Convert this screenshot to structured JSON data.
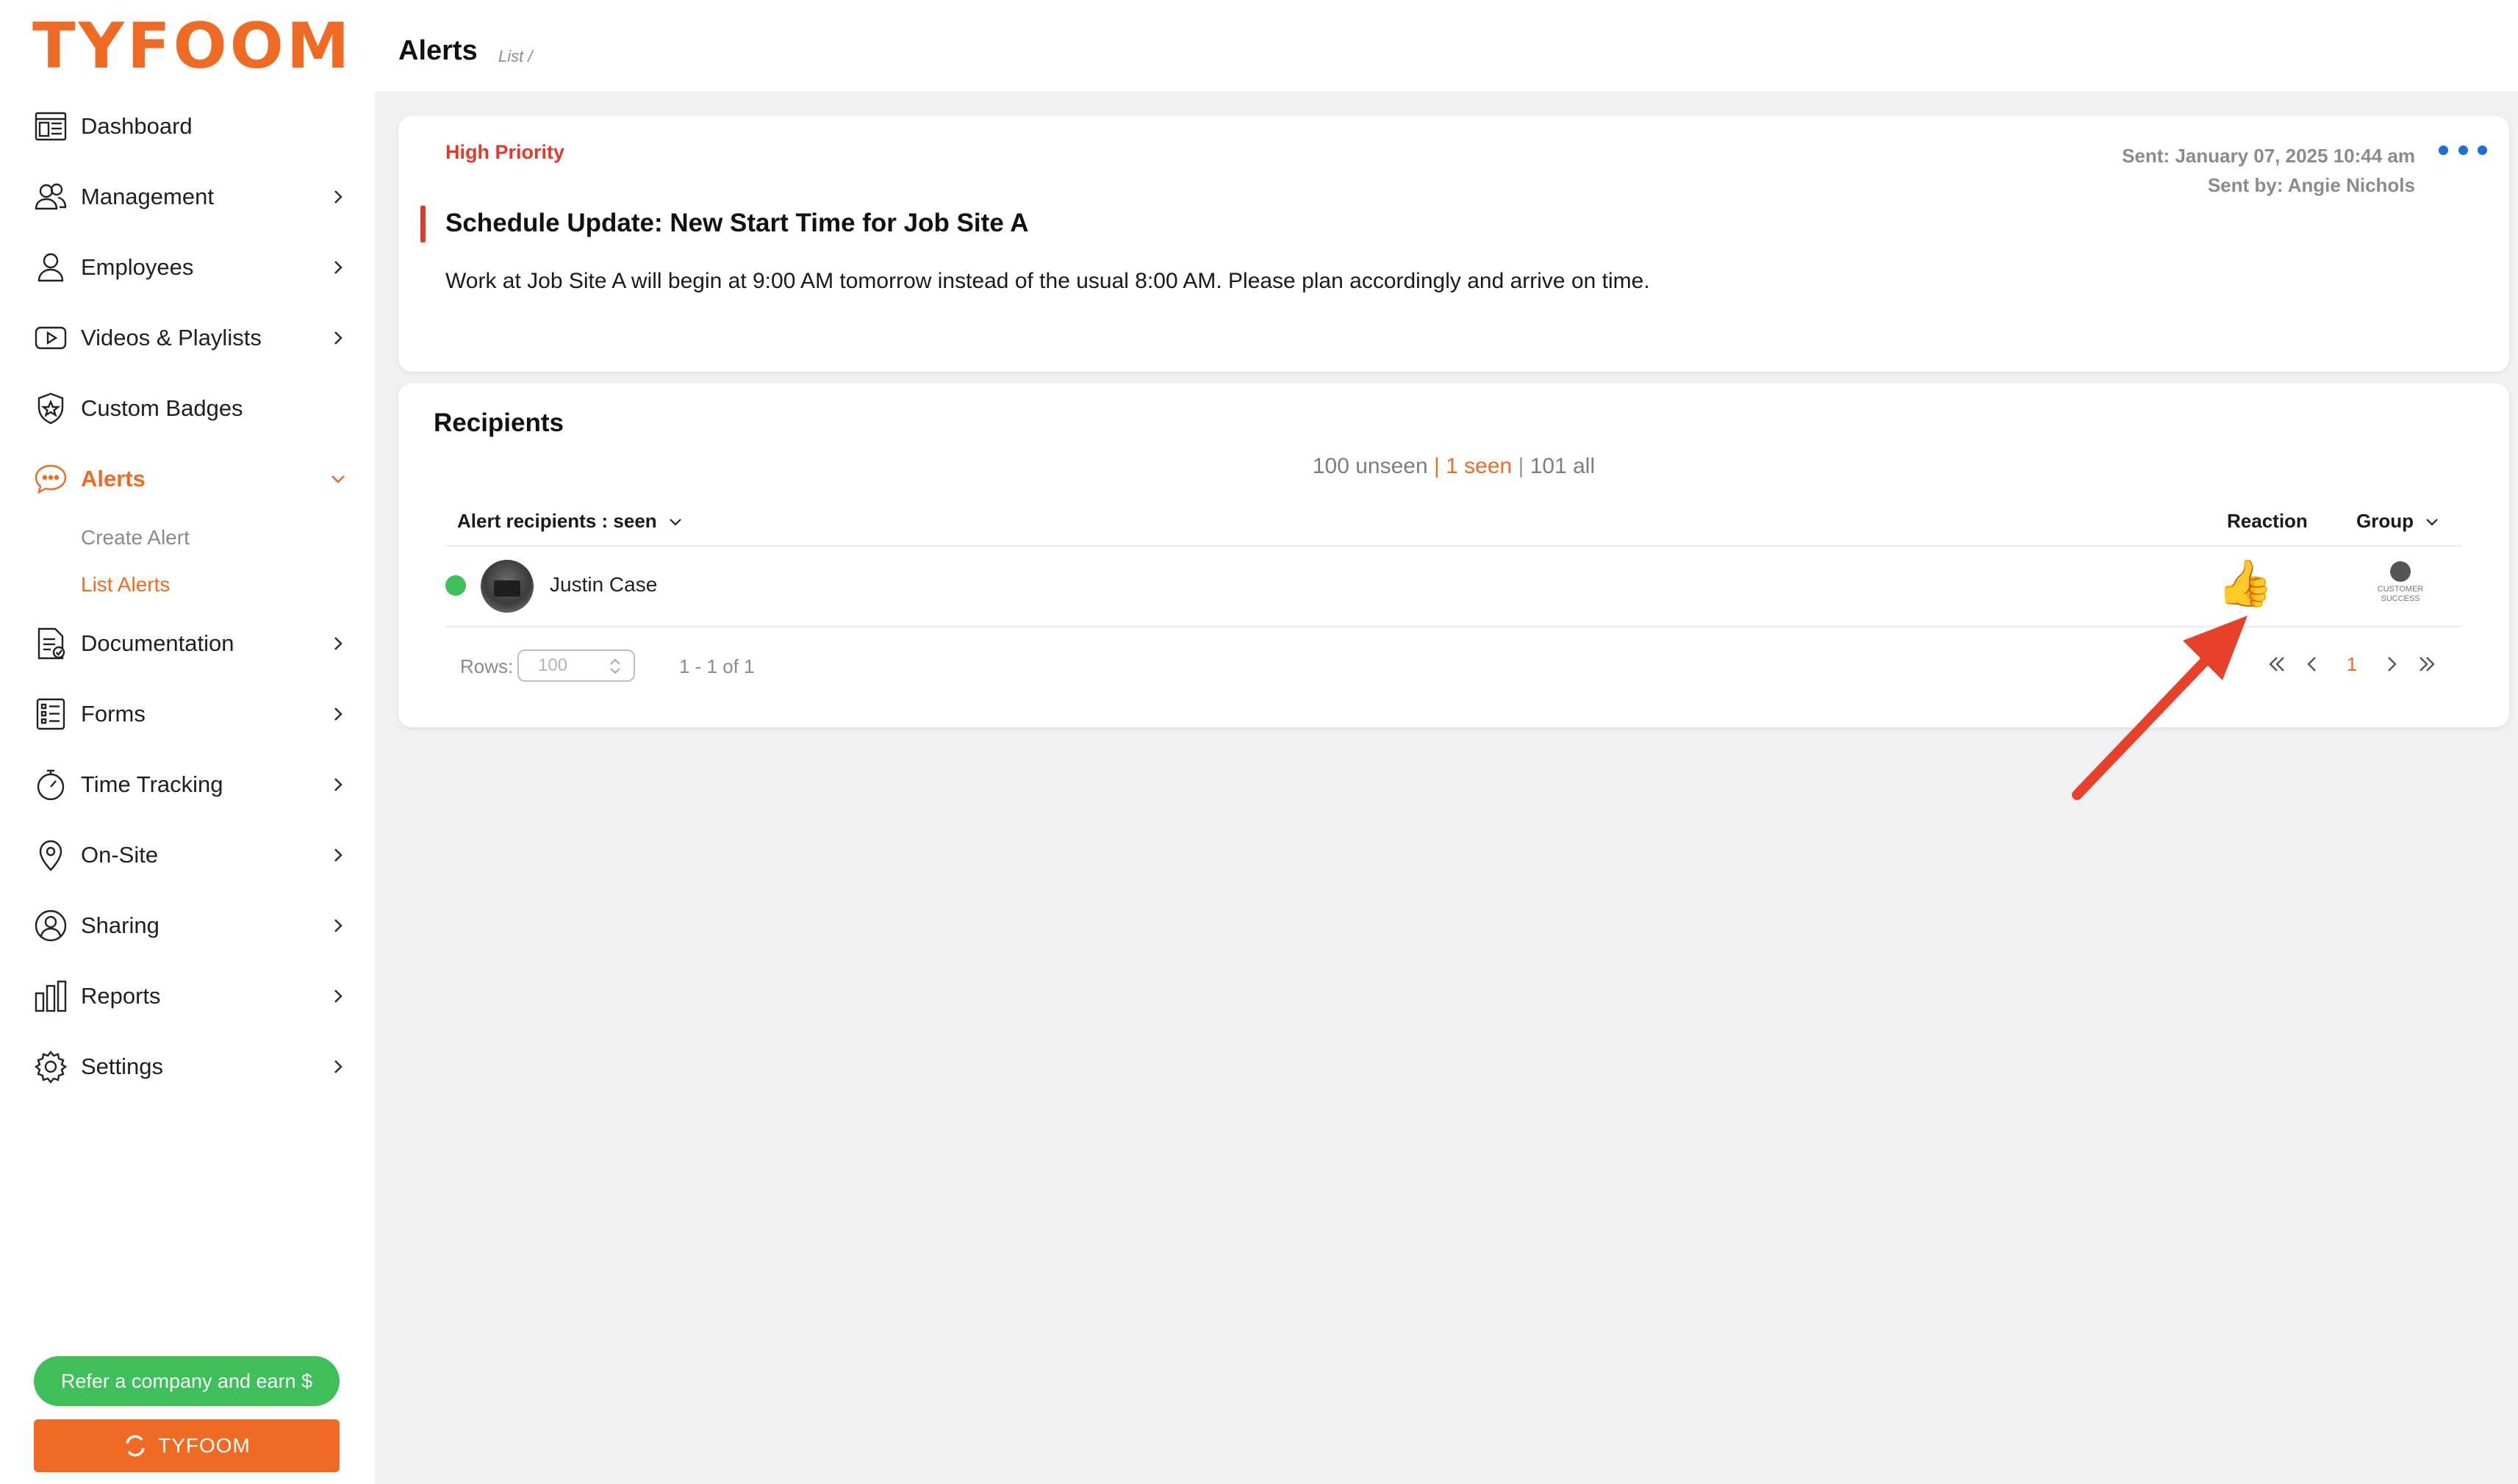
{
  "brand": {
    "logo_text": "TYFOOM",
    "accent": "#ef6a22"
  },
  "header": {
    "title": "Alerts",
    "breadcrumb": "List /"
  },
  "sidebar": {
    "items": [
      {
        "label": "Dashboard",
        "icon": "dashboard-icon",
        "chevron": false
      },
      {
        "label": "Management",
        "icon": "users-icon",
        "chevron": true
      },
      {
        "label": "Employees",
        "icon": "user-icon",
        "chevron": true
      },
      {
        "label": "Videos & Playlists",
        "icon": "play-icon",
        "chevron": true
      },
      {
        "label": "Custom Badges",
        "icon": "badge-icon",
        "chevron": false
      },
      {
        "label": "Alerts",
        "icon": "chat-bubble-icon",
        "chevron": true,
        "active": true
      },
      {
        "label": "Documentation",
        "icon": "document-icon",
        "chevron": true
      },
      {
        "label": "Forms",
        "icon": "list-icon",
        "chevron": true
      },
      {
        "label": "Time Tracking",
        "icon": "stopwatch-icon",
        "chevron": true
      },
      {
        "label": "On-Site",
        "icon": "location-pin-icon",
        "chevron": true
      },
      {
        "label": "Sharing",
        "icon": "share-icon",
        "chevron": true
      },
      {
        "label": "Reports",
        "icon": "bar-chart-icon",
        "chevron": true
      },
      {
        "label": "Settings",
        "icon": "gear-icon",
        "chevron": true
      }
    ],
    "alerts_sub": [
      {
        "label": "Create Alert",
        "active": false
      },
      {
        "label": "List Alerts",
        "active": true
      }
    ],
    "refer_label": "Refer a company and earn $",
    "brand_button_label": "TYFOOM"
  },
  "alert": {
    "priority": "High Priority",
    "sent": "Sent: January 07, 2025 10:44 am",
    "sent_by": "Sent by: Angie Nichols",
    "title": "Schedule Update: New Start Time for Job Site A",
    "body": "Work at Job Site A will begin at 9:00 AM tomorrow instead of the usual 8:00 AM. Please plan accordingly and arrive on time."
  },
  "recipients": {
    "title": "Recipients",
    "filter_unseen": "100 unseen",
    "filter_seen": "1 seen",
    "filter_all": "101 all",
    "columns": {
      "recipient": "Alert recipients : seen",
      "reaction": "Reaction",
      "group": "Group"
    },
    "rows": [
      {
        "name": "Justin Case",
        "status": "online",
        "reaction": "👍",
        "group": "CUSTOMER SUCCESS"
      }
    ],
    "rows_label": "Rows:",
    "rows_value": "100",
    "range": "1 - 1 of 1",
    "page": "1"
  },
  "colors": {
    "accent": "#ef6a22",
    "danger": "#e03a2a",
    "success": "#3fbf5a",
    "link": "#1f6fd6"
  }
}
